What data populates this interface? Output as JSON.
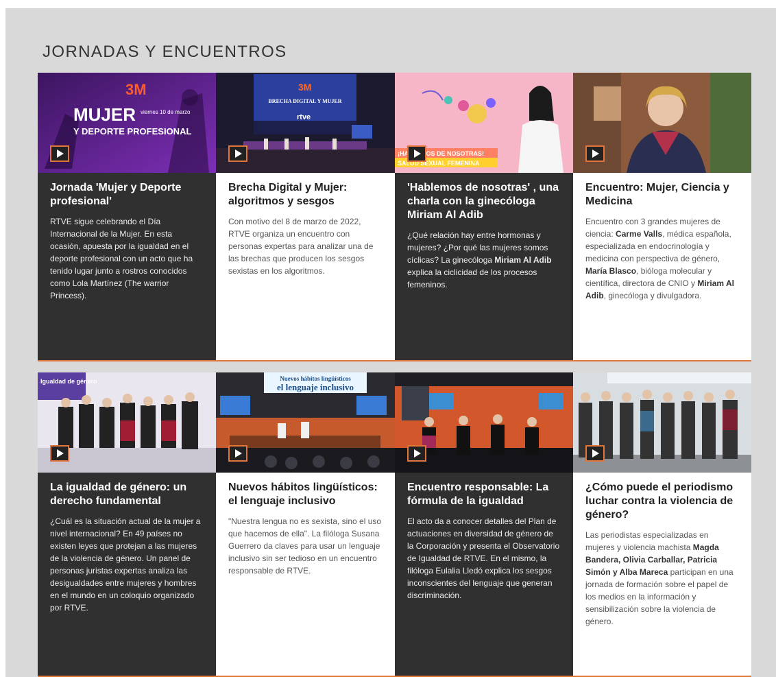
{
  "section": {
    "title": "JORNADAS Y ENCUENTROS"
  },
  "cards": [
    {
      "title": "Jornada 'Mujer y Deporte profesional'",
      "desc": "RTVE sigue celebrando el Día Internacional de la Mujer. En esta ocasión, apuesta por la igualdad en el deporte profesional con un acto que ha tenido lugar junto a rostros conocidos como Lola Martínez (The warrior Princess).",
      "thumb": {
        "logo": "3M",
        "line1": "MUJER",
        "line2": "Y DEPORTE PROFESIONAL",
        "small": "viernes 10 de marzo"
      }
    },
    {
      "title": "Brecha Digital y Mujer: algoritmos y sesgos",
      "desc": "Con motivo del 8 de marzo de 2022, RTVE organiza un encuentro con personas expertas para analizar una de las brechas que producen los sesgos sexistas en los algoritmos.",
      "thumb": {
        "logo": "3M",
        "screen": "BRECHA DIGITAL Y MUJER",
        "brand": "rtve"
      }
    },
    {
      "title": "'Hablemos de nosotras' , una charla con la ginecóloga Miriam Al Adib",
      "desc_parts": [
        "¿Qué relación hay entre hormonas y mujeres? ¿Por qué las mujeres somos cíclicas? La ginecóloga ",
        "Miriam Al Adib",
        " explica la ciclicidad de los procesos femeninos."
      ],
      "thumb": {
        "banner1": "¡HABLEMOS DE NOSOTRAS!",
        "banner2": "SALUD SEXUAL FEMENINA"
      }
    },
    {
      "title": "Encuentro: Mujer, Ciencia y Medicina",
      "desc_parts": [
        "Encuentro con 3 grandes mujeres de ciencia: ",
        "Carme Valls",
        ", médica española, especializada en endocrinología y medicina con perspectiva de género, ",
        "María Blasco",
        ", bióloga molecular y científica, directora de CNIO y ",
        "Miriam Al Adib",
        ", ginecóloga y divulgadora."
      ]
    },
    {
      "title": "La igualdad de género: un derecho fundamental",
      "desc": "¿Cuál es la situación actual de la mujer a nivel internacional? En 49 países no existen leyes que protejan a las mujeres de la violencia de género. Un panel de personas juristas expertas analiza las desigualdades entre mujeres y hombres en el mundo en un coloquio organizado por RTVE.",
      "thumb": {
        "screen": "Igualdad de género"
      }
    },
    {
      "title": "Nuevos hábitos lingüísticos: el lenguaje inclusivo",
      "desc": "\"Nuestra lengua no es sexista, sino el uso que hacemos de ella\". La filóloga Susana Guerrero da claves para usar un lenguaje inclusivo sin ser tedioso en un encuentro responsable de RTVE.",
      "thumb": {
        "screen1": "Nuevos hábitos lingüísticos",
        "screen2": "el lenguaje inclusivo"
      }
    },
    {
      "title": "Encuentro responsable: La fórmula de la igualdad",
      "desc": "El acto da a conocer detalles del Plan de actuaciones en diversidad de género de la Corporación y presenta el Observatorio de Igualdad de RTVE. En el mismo, la filóloga Eulalia Lledó explica los sesgos inconscientes del lenguaje que generan discriminación."
    },
    {
      "title": "¿Cómo puede el periodismo luchar contra la violencia de género?",
      "desc_parts": [
        "Las periodistas especializadas en mujeres y violencia machista ",
        "Magda Bandera, Olivia Carballar, Patricia Simón y Alba Mareca",
        " participan en una jornada de formación sobre el papel de los medios en la información y sensibilización sobre la violencia de género."
      ]
    }
  ]
}
